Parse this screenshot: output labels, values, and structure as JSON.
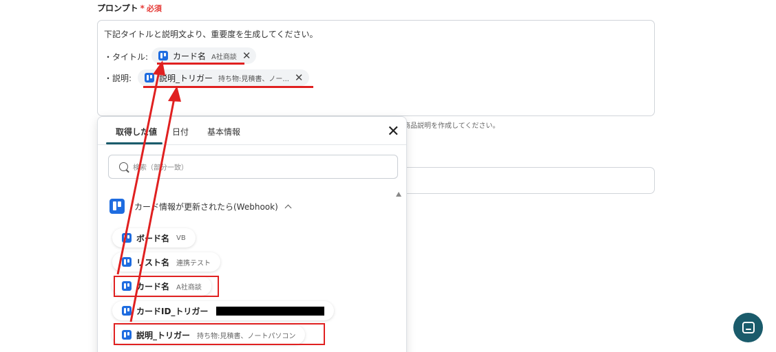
{
  "field": {
    "label": "プロンプト",
    "required_star": "*",
    "required_text": "必須"
  },
  "prompt": {
    "text": "下記タイトルと説明文より、重要度を生成してください。",
    "title_label": "・タイトル:",
    "desc_label": "・説明:",
    "chip_title": {
      "name": "カード名",
      "value": "A社商談"
    },
    "chip_desc": {
      "name": "説明_トリガー",
      "value": "持ち物:見積書、ノー..."
    }
  },
  "helper_text": "商品説明を作成してください。",
  "popup": {
    "tabs": [
      "取得した値",
      "日付",
      "基本情報"
    ],
    "search_placeholder": "検索（部分一致）",
    "section_title": "カード情報が更新されたら(Webhook)",
    "items": [
      {
        "name": "ボード名",
        "value": "VB"
      },
      {
        "name": "リスト名",
        "value": "連携テスト"
      },
      {
        "name": "カード名",
        "value": "A社商談"
      },
      {
        "name": "カードID_トリガー",
        "value": ""
      },
      {
        "name": "説明_トリガー",
        "value": "持ち物:見積書、ノートパソコン"
      }
    ]
  },
  "colors": {
    "accent": "#1a5b6b",
    "highlight": "#e02020",
    "trello": "#1e6ce0",
    "required": "#e53935"
  }
}
